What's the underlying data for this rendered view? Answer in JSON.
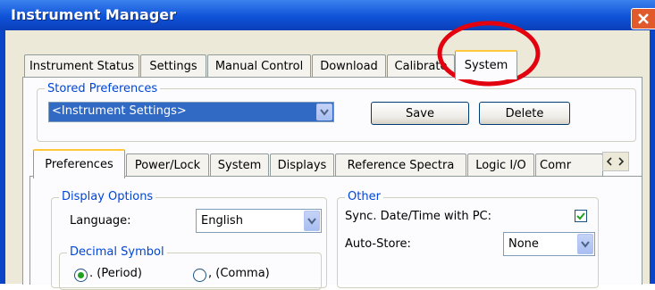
{
  "window": {
    "title": "Instrument Manager"
  },
  "tabs": [
    {
      "label": "Instrument Status"
    },
    {
      "label": "Settings"
    },
    {
      "label": "Manual Control"
    },
    {
      "label": "Download"
    },
    {
      "label": "Calibrate"
    },
    {
      "label": "System",
      "active": true
    }
  ],
  "stored_preferences": {
    "title": "Stored Preferences",
    "selected": "<Instrument Settings>",
    "save_label": "Save",
    "delete_label": "Delete"
  },
  "sub_tabs": [
    {
      "label": "Preferences",
      "active": true
    },
    {
      "label": "Power/Lock"
    },
    {
      "label": "System"
    },
    {
      "label": "Displays"
    },
    {
      "label": "Reference Spectra"
    },
    {
      "label": "Logic I/O"
    },
    {
      "label": "Comr"
    }
  ],
  "display_options": {
    "title": "Display Options",
    "language_label": "Language:",
    "language_value": "English",
    "decimal_symbol_title": "Decimal Symbol",
    "period_label": ". (Period)",
    "comma_label": ", (Comma)",
    "selected_decimal": "period"
  },
  "other": {
    "title": "Other",
    "sync_label": "Sync. Date/Time with PC:",
    "sync_checked": true,
    "autostore_label": "Auto-Store:",
    "autostore_value": "None"
  },
  "annotation": {
    "shape": "ellipse",
    "color": "#e3000f"
  },
  "icons": {
    "close": "close-icon",
    "dropdown": "chevron-down-icon",
    "scroll_left": "arrow-left-icon",
    "scroll_right": "arrow-right-icon",
    "check": "check-icon"
  }
}
